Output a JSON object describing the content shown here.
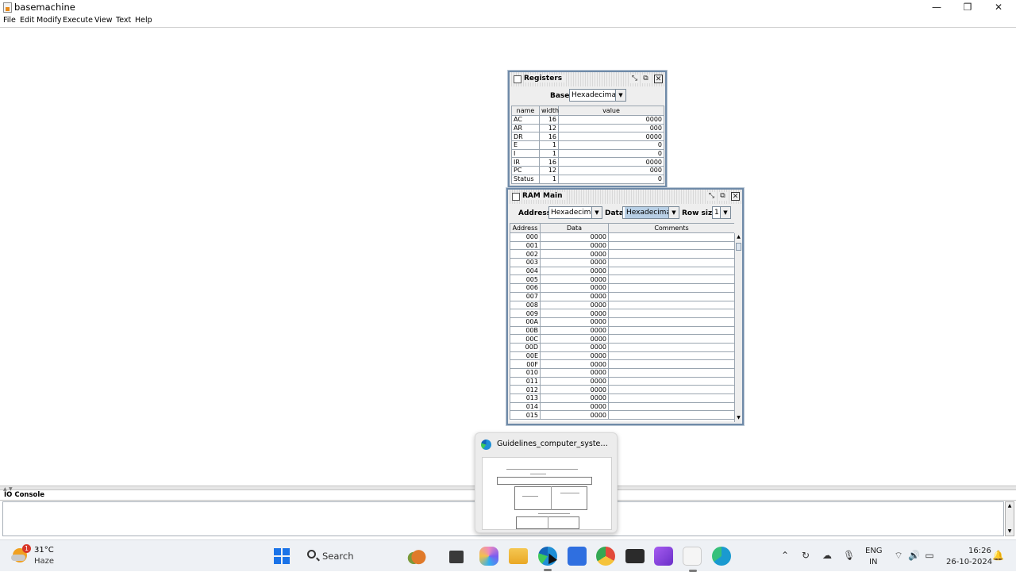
{
  "window": {
    "title": "basemachine",
    "minimize": "—",
    "maximize": "❐",
    "close": "✕"
  },
  "menu": [
    "File",
    "Edit",
    "Modify",
    "Execute",
    "View",
    "Text",
    "Help"
  ],
  "registers": {
    "title": "Registers",
    "base_label": "Base:",
    "base_value": "Hexadecimal",
    "columns": [
      "name",
      "width",
      "value"
    ],
    "rows": [
      [
        "AC",
        "16",
        "0000"
      ],
      [
        "AR",
        "12",
        "000"
      ],
      [
        "DR",
        "16",
        "0000"
      ],
      [
        "E",
        "1",
        "0"
      ],
      [
        "I",
        "1",
        "0"
      ],
      [
        "IR",
        "16",
        "0000"
      ],
      [
        "PC",
        "12",
        "000"
      ],
      [
        "Status",
        "1",
        "0"
      ]
    ]
  },
  "ram": {
    "title": "RAM Main",
    "address_label": "Address:",
    "address_value": "Hexadecimal",
    "data_label": "Data:",
    "data_value": "Hexadecimal",
    "rowsize_label": "Row size:",
    "rowsize_value": "1",
    "columns": [
      "Address",
      "Data",
      "Comments"
    ],
    "rows": [
      [
        "000",
        "0000",
        ""
      ],
      [
        "001",
        "0000",
        ""
      ],
      [
        "002",
        "0000",
        ""
      ],
      [
        "003",
        "0000",
        ""
      ],
      [
        "004",
        "0000",
        ""
      ],
      [
        "005",
        "0000",
        ""
      ],
      [
        "006",
        "0000",
        ""
      ],
      [
        "007",
        "0000",
        ""
      ],
      [
        "008",
        "0000",
        ""
      ],
      [
        "009",
        "0000",
        ""
      ],
      [
        "00A",
        "0000",
        ""
      ],
      [
        "00B",
        "0000",
        ""
      ],
      [
        "00C",
        "0000",
        ""
      ],
      [
        "00D",
        "0000",
        ""
      ],
      [
        "00E",
        "0000",
        ""
      ],
      [
        "00F",
        "0000",
        ""
      ],
      [
        "010",
        "0000",
        ""
      ],
      [
        "011",
        "0000",
        ""
      ],
      [
        "012",
        "0000",
        ""
      ],
      [
        "013",
        "0000",
        ""
      ],
      [
        "014",
        "0000",
        ""
      ],
      [
        "015",
        "0000",
        ""
      ]
    ]
  },
  "io_console": {
    "title": "IO Console"
  },
  "preview": {
    "title": "Guidelines_computer_system_ar..."
  },
  "taskbar": {
    "weather_badge": "1",
    "weather_temp": "31°C",
    "weather_desc": "Haze",
    "search_label": "Search",
    "apps": [
      {
        "name": "fruit-widget-icon",
        "color": "#e07a2a"
      },
      {
        "name": "file-viewer-icon",
        "color": "#3a3a3a"
      },
      {
        "name": "copilot-icon",
        "color": "#7a5cf0"
      },
      {
        "name": "folder-icon",
        "color": "#f2b632"
      },
      {
        "name": "edge-icon",
        "color": "#1f8fd6"
      },
      {
        "name": "store-icon",
        "color": "#2f6fe0"
      },
      {
        "name": "chrome-icon",
        "color": "#e24a3b"
      },
      {
        "name": "terminal-icon",
        "color": "#2b2b2b"
      },
      {
        "name": "clipchamp-icon",
        "color": "#8c3fd8"
      },
      {
        "name": "java-icon",
        "color": "#e88a1a"
      },
      {
        "name": "edge-dev-icon",
        "color": "#1a9ad0"
      }
    ],
    "lang_line1": "ENG",
    "lang_line2": "IN",
    "time": "16:26",
    "date": "26-10-2024"
  }
}
